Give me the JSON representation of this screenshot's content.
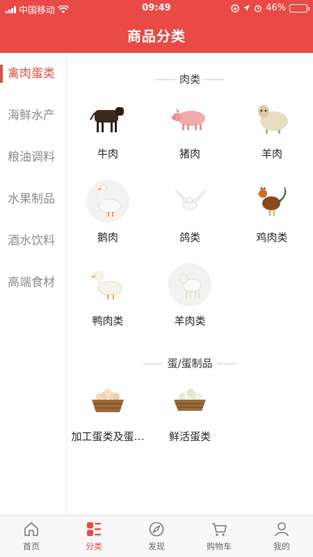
{
  "status_bar": {
    "carrier": "中国移动",
    "time": "09:49",
    "battery": "46%",
    "battery_level": 0.46,
    "accent": "#f5c22c"
  },
  "header": {
    "title": "商品分类",
    "background": "#e94a45"
  },
  "sidebar": {
    "items": [
      {
        "label": "禽肉蛋类",
        "active": true
      },
      {
        "label": "海鲜水产",
        "active": false
      },
      {
        "label": "粮油调料",
        "active": false
      },
      {
        "label": "水果制品",
        "active": false
      },
      {
        "label": "酒水饮料",
        "active": false
      },
      {
        "label": "高端食材",
        "active": false
      }
    ]
  },
  "sections": [
    {
      "title": "肉类",
      "items": [
        {
          "label": "牛肉",
          "icon": "cow-icon"
        },
        {
          "label": "猪肉",
          "icon": "pig-icon"
        },
        {
          "label": "羊肉",
          "icon": "sheep-icon"
        },
        {
          "label": "鹅肉",
          "icon": "goose-icon"
        },
        {
          "label": "鸽类",
          "icon": "pigeon-icon"
        },
        {
          "label": "鸡肉类",
          "icon": "rooster-icon"
        },
        {
          "label": "鸭肉类",
          "icon": "duck-icon"
        },
        {
          "label": "羊肉类",
          "icon": "lamb-icon"
        }
      ]
    },
    {
      "title": "蛋/蛋制品",
      "items": [
        {
          "label": "加工蛋类及蛋…",
          "icon": "egg-basket-icon"
        },
        {
          "label": "鲜活蛋类",
          "icon": "fresh-egg-basket-icon"
        }
      ]
    }
  ],
  "tabbar": {
    "tabs": [
      {
        "label": "首页",
        "icon": "home-icon",
        "active": false
      },
      {
        "label": "分类",
        "icon": "category-icon",
        "active": true
      },
      {
        "label": "发现",
        "icon": "discover-icon",
        "active": false
      },
      {
        "label": "购物车",
        "icon": "cart-icon",
        "active": false
      },
      {
        "label": "我的",
        "icon": "profile-icon",
        "active": false
      }
    ]
  }
}
